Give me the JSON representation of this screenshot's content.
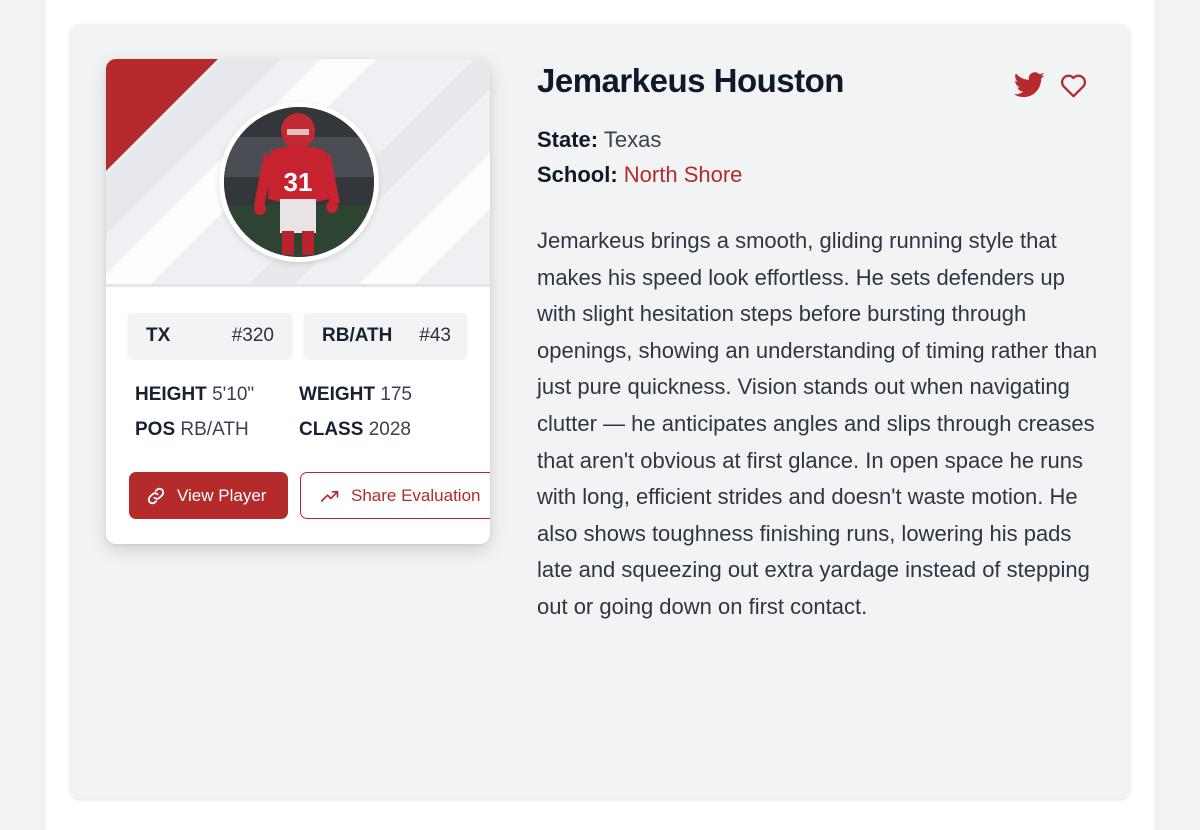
{
  "player": {
    "name": "Jemarkeus Houston",
    "state_label": "State:",
    "state": "Texas",
    "school_label": "School:",
    "school": "North Shore",
    "bio": "Jemarkeus brings a smooth, gliding running style that makes his speed look effortless. He sets defenders up with slight hesitation steps before bursting through openings, showing an understanding of timing rather than just pure quickness. Vision stands out when navigating clutter — he anticipates angles and slips through creases that aren't obvious at first glance. In open space he runs with long, efficient strides and doesn't waste motion. He also shows toughness finishing runs, lowering his pads late and squeezing out extra yardage instead of stepping out or going down on first contact."
  },
  "card": {
    "chips": {
      "state_abbr": "TX",
      "state_rank": "#320",
      "position": "RB/ATH",
      "position_rank": "#43"
    },
    "stats": {
      "height_label": "HEIGHT",
      "height": "5'10\"",
      "weight_label": "WEIGHT",
      "weight": "175",
      "pos_label": "POS",
      "pos": "RB/ATH",
      "class_label": "CLASS",
      "class": "2028"
    },
    "buttons": {
      "view_player": "View Player",
      "share_evaluation": "Share Evaluation"
    },
    "jersey_number": "31"
  },
  "icons": {
    "link": "link-icon",
    "trend": "trending-up-icon",
    "social": "twitter-icon",
    "favorite": "heart-icon"
  },
  "colors": {
    "accent": "#b52a2a",
    "text_dark": "#111827",
    "panel_bg": "#f2f3f5"
  }
}
